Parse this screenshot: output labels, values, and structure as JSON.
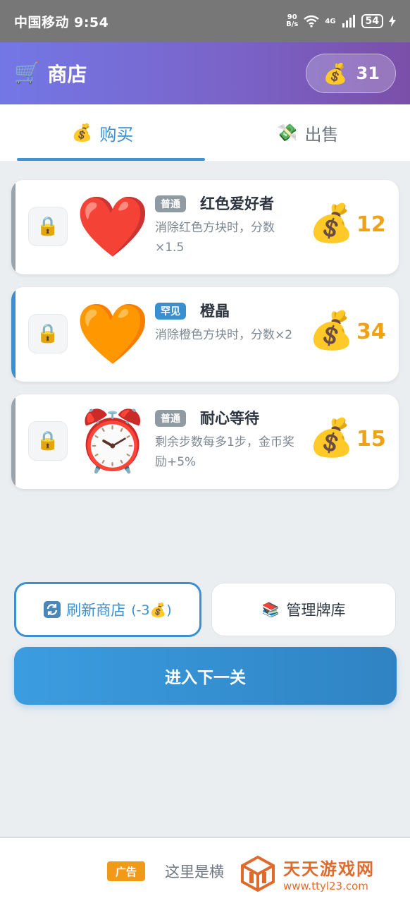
{
  "status_bar": {
    "carrier_time": "中国移动 9:54",
    "net_speed_top": "90",
    "net_speed_bottom": "B/s",
    "network": "4G",
    "battery": "54"
  },
  "header": {
    "icon": "shopping-cart-icon",
    "title": "商店",
    "coins": "31",
    "coin_icon": "money-bag-icon"
  },
  "tabs": [
    {
      "label": "购买",
      "icon": "money-bag-icon",
      "active": true
    },
    {
      "label": "出售",
      "icon": "money-with-wings-icon",
      "active": false
    }
  ],
  "items": [
    {
      "rarity": "普通",
      "rarity_color": "#8f9aa3",
      "name": "红色爱好者",
      "desc": "消除红色方块时，分数×1.5",
      "price": "12",
      "emoji": "❤️",
      "icon": "red-heart-icon",
      "edge_color": "#9aa4ac",
      "locked": true
    },
    {
      "rarity": "罕见",
      "rarity_color": "#3a8fd0",
      "name": "橙晶",
      "desc": "消除橙色方块时，分数×2",
      "price": "34",
      "emoji": "🧡",
      "icon": "orange-heart-icon",
      "edge_color": "#3a8fd0",
      "locked": true
    },
    {
      "rarity": "普通",
      "rarity_color": "#8f9aa3",
      "name": "耐心等待",
      "desc": "剩余步数每多1步，金币奖励+5%",
      "price": "15",
      "emoji": "⏰",
      "icon": "alarm-clock-icon",
      "edge_color": "#9aa4ac",
      "locked": true
    }
  ],
  "buttons": {
    "refresh_label": "刷新商店",
    "refresh_cost": "(-3",
    "refresh_cost_end": ")",
    "manage_label": "管理牌库",
    "next_label": "进入下一关"
  },
  "ad": {
    "tag": "广告",
    "text": "这里是横"
  },
  "watermark": {
    "title": "天天游戏网",
    "url": "www.ttyl23.com"
  },
  "colors": {
    "accent": "#3a8fd0",
    "price": "#f0a116",
    "header_start": "#7377e6",
    "header_end": "#7a4fa8"
  }
}
